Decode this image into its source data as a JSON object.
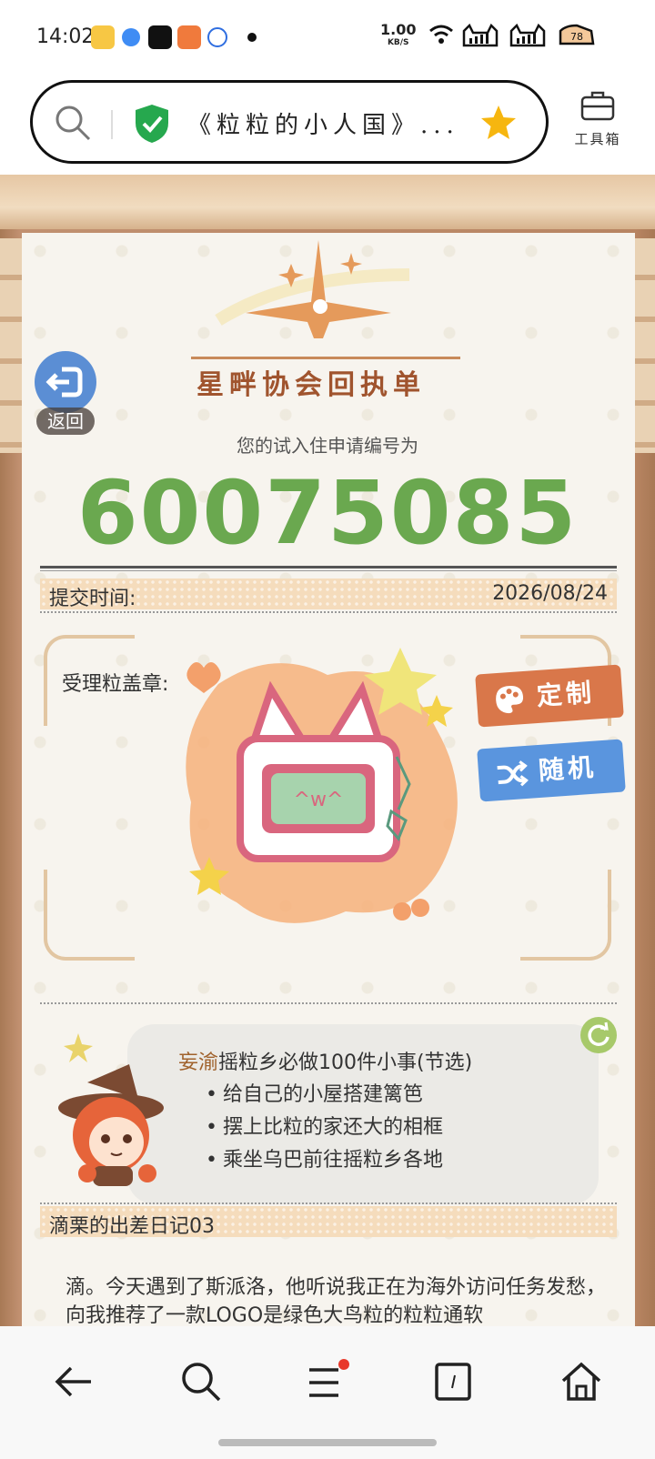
{
  "status_bar": {
    "time": "14:02",
    "net_speed": "1.00",
    "net_unit": "KB/S"
  },
  "address_bar": {
    "title": "《粒粒的小人国》...",
    "toolbox_label": "工具箱"
  },
  "page": {
    "back_label": "返回",
    "form_title": "星畔协会回执单",
    "apply_label": "您的试入住申请编号为",
    "apply_number": "60075085",
    "submit_label": "提交时间:",
    "submit_date": "2026/08/24",
    "stamp_label": "受理粒盖章:",
    "stamp_face": "^w^",
    "custom_button": "定制",
    "random_button": "随机",
    "todo": {
      "author": "妄渝",
      "title_rest": "摇粒乡必做100件小事(节选)",
      "items": [
        "给自己的小屋搭建篱笆",
        "摆上比粒的家还大的相框",
        "乘坐乌巴前往摇粒乡各地"
      ]
    },
    "diary_title": "滴栗的出差日记03",
    "diary_text": "滴。今天遇到了斯派洛，他听说我正在为海外访问任务发愁，向我推荐了一款LOGO是绿色大鸟粒的粒粒通软"
  },
  "colors": {
    "accent_green": "#6aa84f",
    "title_brown": "#a0542e",
    "custom_orange": "#d9774a",
    "random_blue": "#5a95de",
    "back_blue": "#5b8ed4"
  },
  "icons": [
    "search-icon",
    "shield-check-icon",
    "star-icon",
    "toolbox-icon",
    "back-arrow-icon",
    "palette-icon",
    "shuffle-icon",
    "refresh-icon",
    "nav-back-icon",
    "nav-search-icon",
    "nav-menu-icon",
    "nav-tabs-icon",
    "nav-home-icon"
  ]
}
